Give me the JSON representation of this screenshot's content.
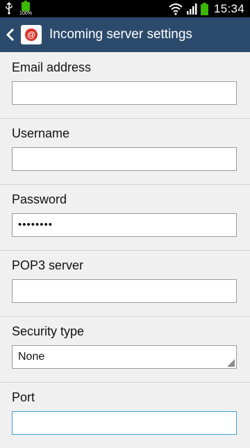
{
  "status_bar": {
    "battery_small_label": "100%",
    "time": "15:34",
    "icons": [
      "usb-icon",
      "battery-icon",
      "wifi-icon",
      "signal-icon",
      "battery-icon"
    ]
  },
  "app_bar": {
    "title": "Incoming server settings",
    "back_icon": "chevron-left-icon",
    "app_icon": "email-at-icon"
  },
  "form": {
    "email": {
      "label": "Email address",
      "value": ""
    },
    "username": {
      "label": "Username",
      "value": ""
    },
    "password": {
      "label": "Password",
      "value": "••••••••"
    },
    "pop3": {
      "label": "POP3 server",
      "value": ""
    },
    "security": {
      "label": "Security type",
      "value": "None"
    },
    "port": {
      "label": "Port",
      "value": ""
    }
  },
  "colors": {
    "app_bar": "#2c4b6c",
    "accent": "#3aa0d8",
    "battery": "#3cb700",
    "email_icon": "#d9342b"
  }
}
